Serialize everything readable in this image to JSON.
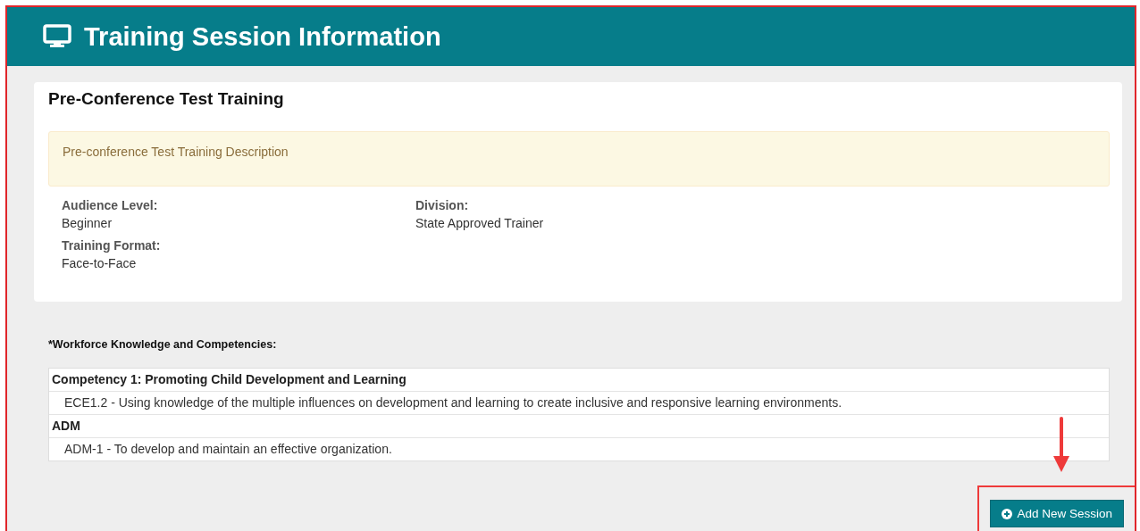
{
  "header": {
    "title": "Training Session Information"
  },
  "training": {
    "title": "Pre-Conference Test Training",
    "description": "Pre-conference Test Training Description",
    "fields": [
      {
        "label": "Audience Level:",
        "value": "Beginner"
      },
      {
        "label": "Division:",
        "value": "State Approved Trainer"
      },
      {
        "label": "Training Format:",
        "value": "Face-to-Face"
      }
    ]
  },
  "competencies": {
    "label": "*Workforce Knowledge and Competencies:",
    "rows": [
      {
        "kind": "group",
        "text": "Competency 1: Promoting Child Development and Learning"
      },
      {
        "kind": "item",
        "text": "ECE1.2 - Using knowledge of the multiple influences on development and learning to create inclusive and responsive learning environments."
      },
      {
        "kind": "group",
        "text": "ADM"
      },
      {
        "kind": "item",
        "text": "ADM-1 - To develop and maintain an effective organization."
      }
    ]
  },
  "add_button": {
    "label": "Add New Session",
    "highlighted": true
  }
}
